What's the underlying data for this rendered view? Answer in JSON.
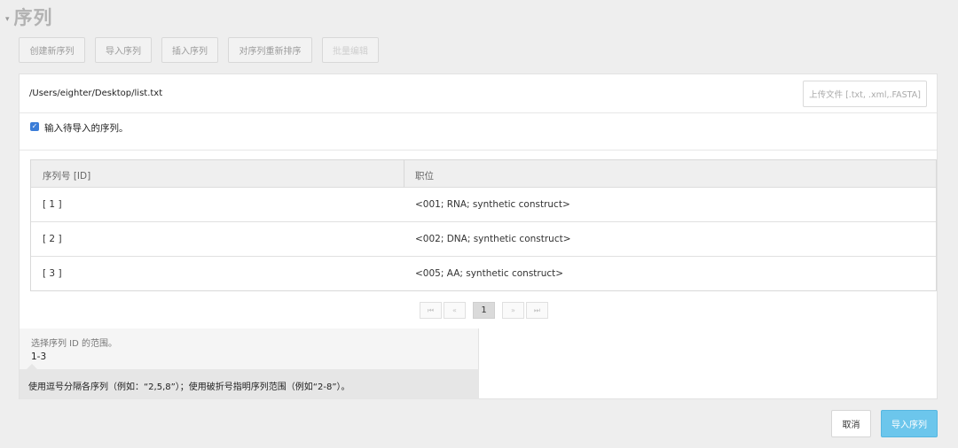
{
  "page": {
    "title": "序列",
    "caret": "▾"
  },
  "toolbar": {
    "create": "创建新序列",
    "import": "导入序列",
    "insert": "插入序列",
    "reorder": "对序列重新排序",
    "batch_edit": "批量编辑"
  },
  "file": {
    "path": "/Users/eighter/Desktop/list.txt",
    "upload_label": "上传文件 [.txt, .xml,.FASTA]"
  },
  "checkbox": {
    "checked": true,
    "label": "输入待导入的序列。"
  },
  "table": {
    "headers": [
      "序列号 [ID]",
      "职位"
    ],
    "rows": [
      [
        "[ 1 ]",
        "<001; RNA; synthetic construct>"
      ],
      [
        "[ 2 ]",
        "<002; DNA; synthetic construct>"
      ],
      [
        "[ 3 ]",
        "<005; AA; synthetic construct>"
      ]
    ]
  },
  "pagination": {
    "first": "⏮",
    "prev": "«",
    "current": "1",
    "next": "»",
    "last": "⏭"
  },
  "range": {
    "label": "选择序列 ID 的范围。",
    "value": "1-3",
    "tip": "使用逗号分隔各序列（例如：“2,5,8”）；使用破折号指明序列范围（例如“2-8”）。"
  },
  "footer": {
    "cancel": "取消",
    "import": "导入序列"
  },
  "colors": {
    "accent": "#6cc6ec",
    "checkbox": "#3b7dd8"
  }
}
